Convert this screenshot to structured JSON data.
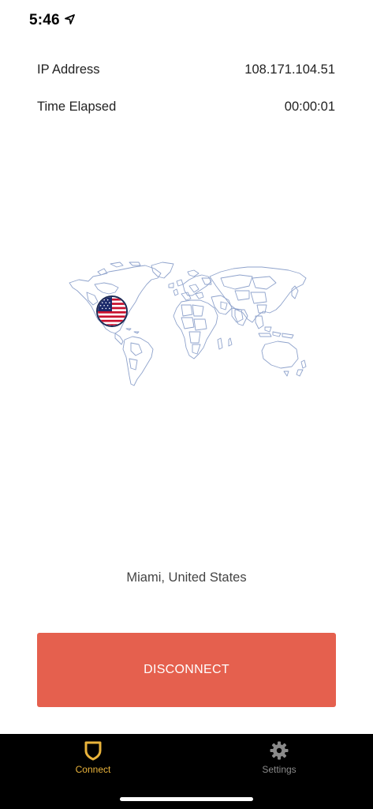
{
  "status_bar": {
    "time": "5:46",
    "location_icon": "location-arrow-icon"
  },
  "info": {
    "ip_label": "IP Address",
    "ip_value": "108.171.104.51",
    "time_label": "Time Elapsed",
    "time_value": "00:00:01"
  },
  "map": {
    "icon": "world-map",
    "marker_icon": "us-flag-icon"
  },
  "location": "Miami, United States",
  "disconnect_label": "DISCONNECT",
  "tabs": [
    {
      "label": "Connect",
      "icon": "shield-icon",
      "active": true
    },
    {
      "label": "Settings",
      "icon": "gear-icon",
      "active": false
    }
  ],
  "colors": {
    "accent": "#e9b33b",
    "disconnect": "#e5604e",
    "map_line": "#8fa3cc",
    "tab_bar": "#000000"
  }
}
